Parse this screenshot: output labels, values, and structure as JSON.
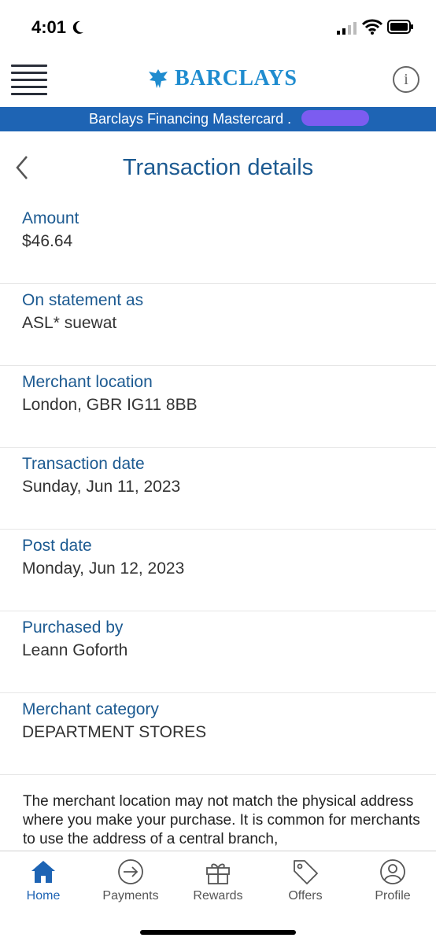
{
  "status": {
    "time": "4:01"
  },
  "header": {
    "brand": "BARCLAYS",
    "info_glyph": "i"
  },
  "account": {
    "name": "Barclays Financing Mastercard ."
  },
  "page": {
    "title": "Transaction details"
  },
  "details": [
    {
      "label": "Amount",
      "value": "$46.64"
    },
    {
      "label": "On statement as",
      "value": "ASL* suewat"
    },
    {
      "label": "Merchant location",
      "value": "London, GBR IG11 8BB"
    },
    {
      "label": "Transaction date",
      "value": "Sunday, Jun 11, 2023"
    },
    {
      "label": "Post date",
      "value": "Monday, Jun 12, 2023"
    },
    {
      "label": "Purchased by",
      "value": "Leann Goforth"
    },
    {
      "label": "Merchant category",
      "value": "DEPARTMENT STORES"
    }
  ],
  "disclaimer": "The merchant location may not match the physical address where you make your purchase. It is common for merchants to use the address of a central branch,",
  "tabs": [
    {
      "label": "Home",
      "icon": "home-icon",
      "active": true
    },
    {
      "label": "Payments",
      "icon": "payments-icon",
      "active": false
    },
    {
      "label": "Rewards",
      "icon": "gift-icon",
      "active": false
    },
    {
      "label": "Offers",
      "icon": "tag-icon",
      "active": false
    },
    {
      "label": "Profile",
      "icon": "profile-icon",
      "active": false
    }
  ],
  "colors": {
    "brand_blue": "#1f8ccf",
    "banner_blue": "#1e64b4",
    "label_blue": "#1c5a91"
  }
}
